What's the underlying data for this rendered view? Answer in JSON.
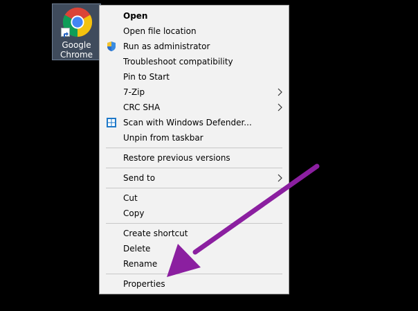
{
  "desktop": {
    "shortcut": {
      "icon": "google-chrome-icon",
      "label_line1": "Google",
      "label_line2": "Chrome"
    }
  },
  "context_menu": {
    "items": [
      {
        "label": "Open",
        "bold": true
      },
      {
        "label": "Open file location"
      },
      {
        "label": "Run as administrator",
        "icon": "uac-shield-icon"
      },
      {
        "label": "Troubleshoot compatibility"
      },
      {
        "label": "Pin to Start"
      },
      {
        "label": "7-Zip",
        "submenu": true
      },
      {
        "label": "CRC SHA",
        "submenu": true
      },
      {
        "label": "Scan with Windows Defender...",
        "icon": "windows-defender-icon"
      },
      {
        "label": "Unpin from taskbar"
      },
      {
        "label": "Restore previous versions"
      },
      {
        "label": "Send to",
        "submenu": true
      },
      {
        "label": "Cut"
      },
      {
        "label": "Copy"
      },
      {
        "label": "Create shortcut"
      },
      {
        "label": "Delete"
      },
      {
        "label": "Rename"
      },
      {
        "label": "Properties"
      }
    ]
  },
  "annotation": {
    "type": "arrow",
    "color": "#8b1fa0",
    "points_to": "Properties"
  }
}
